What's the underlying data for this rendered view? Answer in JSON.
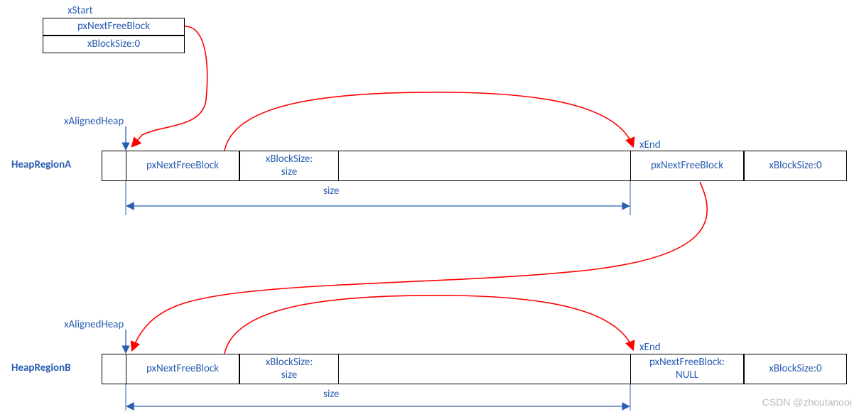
{
  "diagram": {
    "xstart": {
      "title": "xStart",
      "pxNext": "pxNextFreeBlock",
      "size": "xBlockSize:0"
    },
    "regionA": {
      "name": "HeapRegionA",
      "alignedLabel": "xAlignedHeap",
      "endLabel": "xEnd",
      "sizeDim": "size",
      "block0": {
        "pxNext": "pxNextFreeBlock",
        "size": "xBlockSize:\nsize"
      },
      "endBlock": {
        "pxNext": "pxNextFreeBlock",
        "size": "xBlockSize:0"
      }
    },
    "regionB": {
      "name": "HeapRegionB",
      "alignedLabel": "xAlignedHeap",
      "endLabel": "xEnd",
      "sizeDim": "size",
      "block0": {
        "pxNext": "pxNextFreeBlock",
        "size": "xBlockSize:\nsize"
      },
      "endBlock": {
        "pxNext": "pxNextFreeBlock:\nNULL",
        "size": "xBlockSize:0"
      }
    },
    "watermark": "CSDN @zhoutanooi"
  }
}
